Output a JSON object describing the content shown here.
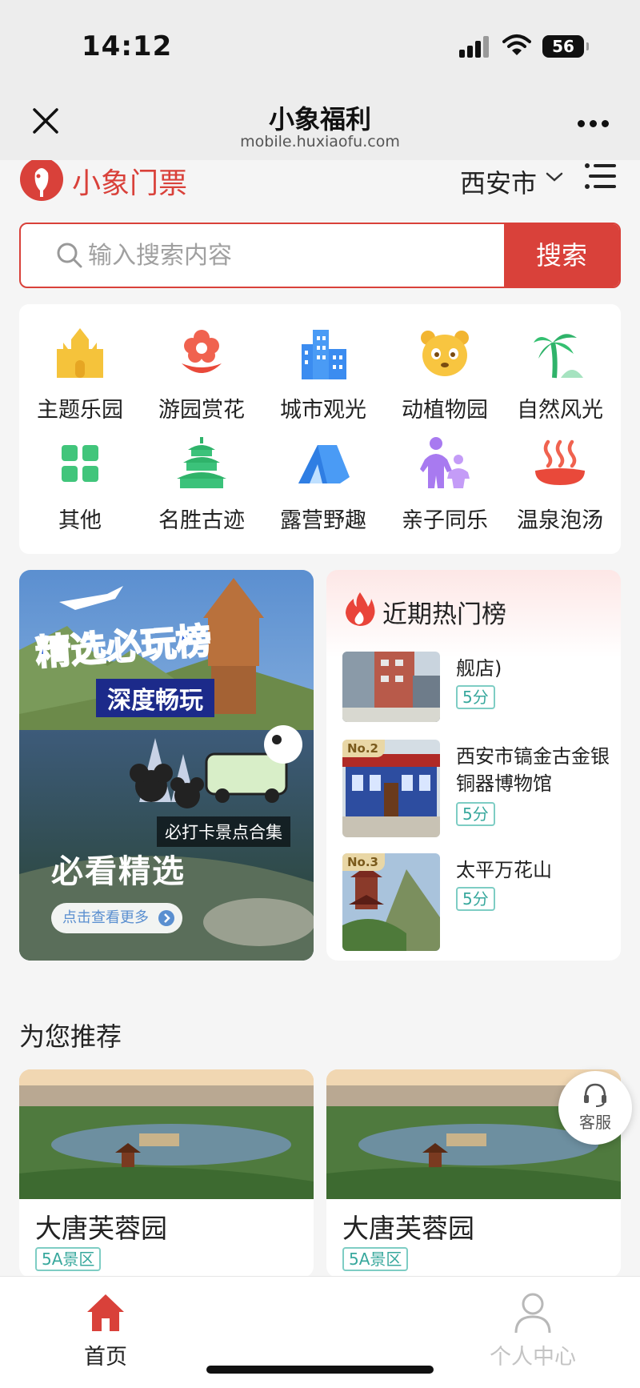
{
  "status_bar": {
    "time": "14:12",
    "battery": "56"
  },
  "nav": {
    "title": "小象福利",
    "subtitle": "mobile.huxiaofu.com"
  },
  "header": {
    "logo_text": "小象门票",
    "city": "西安市"
  },
  "search": {
    "placeholder": "输入搜索内容",
    "button_label": "搜索"
  },
  "categories": [
    {
      "label": "主题乐园",
      "icon": "castle-icon"
    },
    {
      "label": "游园赏花",
      "icon": "flower-icon"
    },
    {
      "label": "城市观光",
      "icon": "buildings-icon"
    },
    {
      "label": "动植物园",
      "icon": "panda-icon"
    },
    {
      "label": "自然风光",
      "icon": "palm-icon"
    },
    {
      "label": "其他",
      "icon": "grid-icon"
    },
    {
      "label": "名胜古迹",
      "icon": "temple-icon"
    },
    {
      "label": "露营野趣",
      "icon": "tent-icon"
    },
    {
      "label": "亲子同乐",
      "icon": "family-icon"
    },
    {
      "label": "温泉泡汤",
      "icon": "hotspring-icon"
    }
  ],
  "feature": {
    "headline": "精选必玩榜",
    "ribbon": "深度畅玩",
    "caption": "必打卡景点合集",
    "title": "必看精选",
    "more_button": "点击查看更多"
  },
  "hot_list": {
    "title": "近期热门榜",
    "items": [
      {
        "name": "舰店)",
        "score": "5分",
        "rank": ""
      },
      {
        "name": "西安市镐金古金银铜器博物馆",
        "score": "5分",
        "rank": "No.2"
      },
      {
        "name": "太平万花山",
        "score": "5分",
        "rank": "No.3"
      }
    ]
  },
  "recommend": {
    "title": "为您推荐",
    "items": [
      {
        "name": "大唐芙蓉园",
        "tag": "5A景区"
      },
      {
        "name": "大唐芙蓉园",
        "tag": "5A景区"
      }
    ]
  },
  "service": {
    "label": "客服"
  },
  "tabs": [
    {
      "label": "首页",
      "icon": "home-icon",
      "active": true,
      "color": "#d9413a"
    },
    {
      "label": "个人中心",
      "icon": "user-icon",
      "active": false,
      "color": "#c4c4c4"
    }
  ],
  "colors": {
    "brand": "#d9413a",
    "tag": "#38a89d"
  }
}
